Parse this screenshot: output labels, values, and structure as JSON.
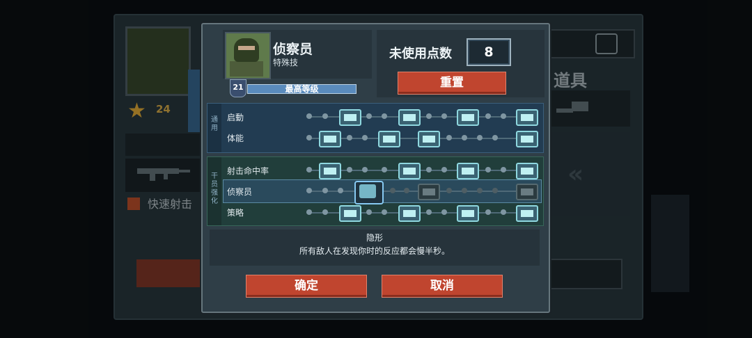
{
  "background": {
    "level": "24",
    "fast_shot_label": "快速射击",
    "items_title": "道具"
  },
  "profile": {
    "name": "侦察员",
    "subtitle": "特殊技",
    "level": "21",
    "level_status": "最高等级"
  },
  "points": {
    "label": "未使用点数",
    "value": "8",
    "reset_label": "重置"
  },
  "tree": {
    "group1_label": "通用",
    "group2_label": "干员强化",
    "rows": [
      {
        "label": "启動"
      },
      {
        "label": "体能"
      },
      {
        "label": "射击命中率"
      },
      {
        "label": "侦察员"
      },
      {
        "label": "策略"
      }
    ]
  },
  "description": {
    "title": "隐形",
    "text": "所有敌人在发现你时的反应都会慢半秒。"
  },
  "buttons": {
    "confirm": "确定",
    "cancel": "取消"
  },
  "colors": {
    "accent_red": "#c0452f",
    "node_cyan": "#8fd8e0",
    "group_blue": "#223c52",
    "group_green": "#213e3b"
  }
}
